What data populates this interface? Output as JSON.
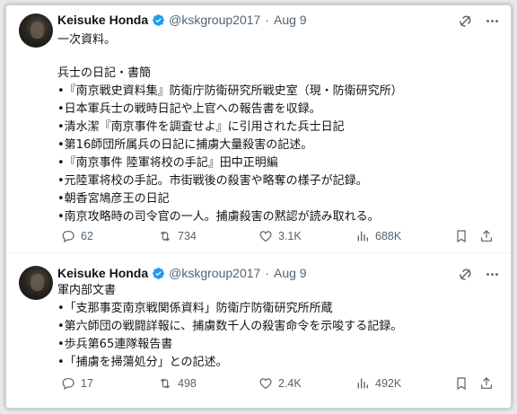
{
  "tweets": [
    {
      "author": {
        "name": "Keisuke Honda",
        "handle": "@kskgroup2017",
        "date": "Aug 9"
      },
      "lines": [
        "一次資料。",
        "",
        "兵士の日記・書簡",
        "•『南京戦史資料集』防衛庁防衛研究所戦史室（現・防衛研究所）",
        "•日本軍兵士の戦時日記や上官への報告書を収録。",
        "•清水潔『南京事件を調査せよ』に引用された兵士日記",
        "•第16師団所属兵の日記に捕虜大量殺害の記述。",
        "•『南京事件 陸軍将校の手記』田中正明編",
        "•元陸軍将校の手記。市街戦後の殺害や略奪の様子が記録。",
        "•朝香宮鳩彦王の日記",
        "•南京攻略時の司令官の一人。捕虜殺害の黙認が読み取れる。"
      ],
      "stats": {
        "replies": "62",
        "reposts": "734",
        "likes": "3.1K",
        "views": "688K"
      }
    },
    {
      "author": {
        "name": "Keisuke Honda",
        "handle": "@kskgroup2017",
        "date": "Aug 9"
      },
      "lines": [
        "軍内部文書",
        "•「支那事変南京戦関係資料」防衛庁防衛研究所所蔵",
        "•第六師団の戦闘詳報に、捕虜数千人の殺害命令を示唆する記録。",
        "•歩兵第65連隊報告書",
        "•「捕虜を掃蕩処分」との記述。"
      ],
      "stats": {
        "replies": "17",
        "reposts": "498",
        "likes": "2.4K",
        "views": "492K"
      }
    }
  ],
  "colors": {
    "verified": "#1d9bf0",
    "muted": "#536471",
    "text": "#0f1419"
  }
}
